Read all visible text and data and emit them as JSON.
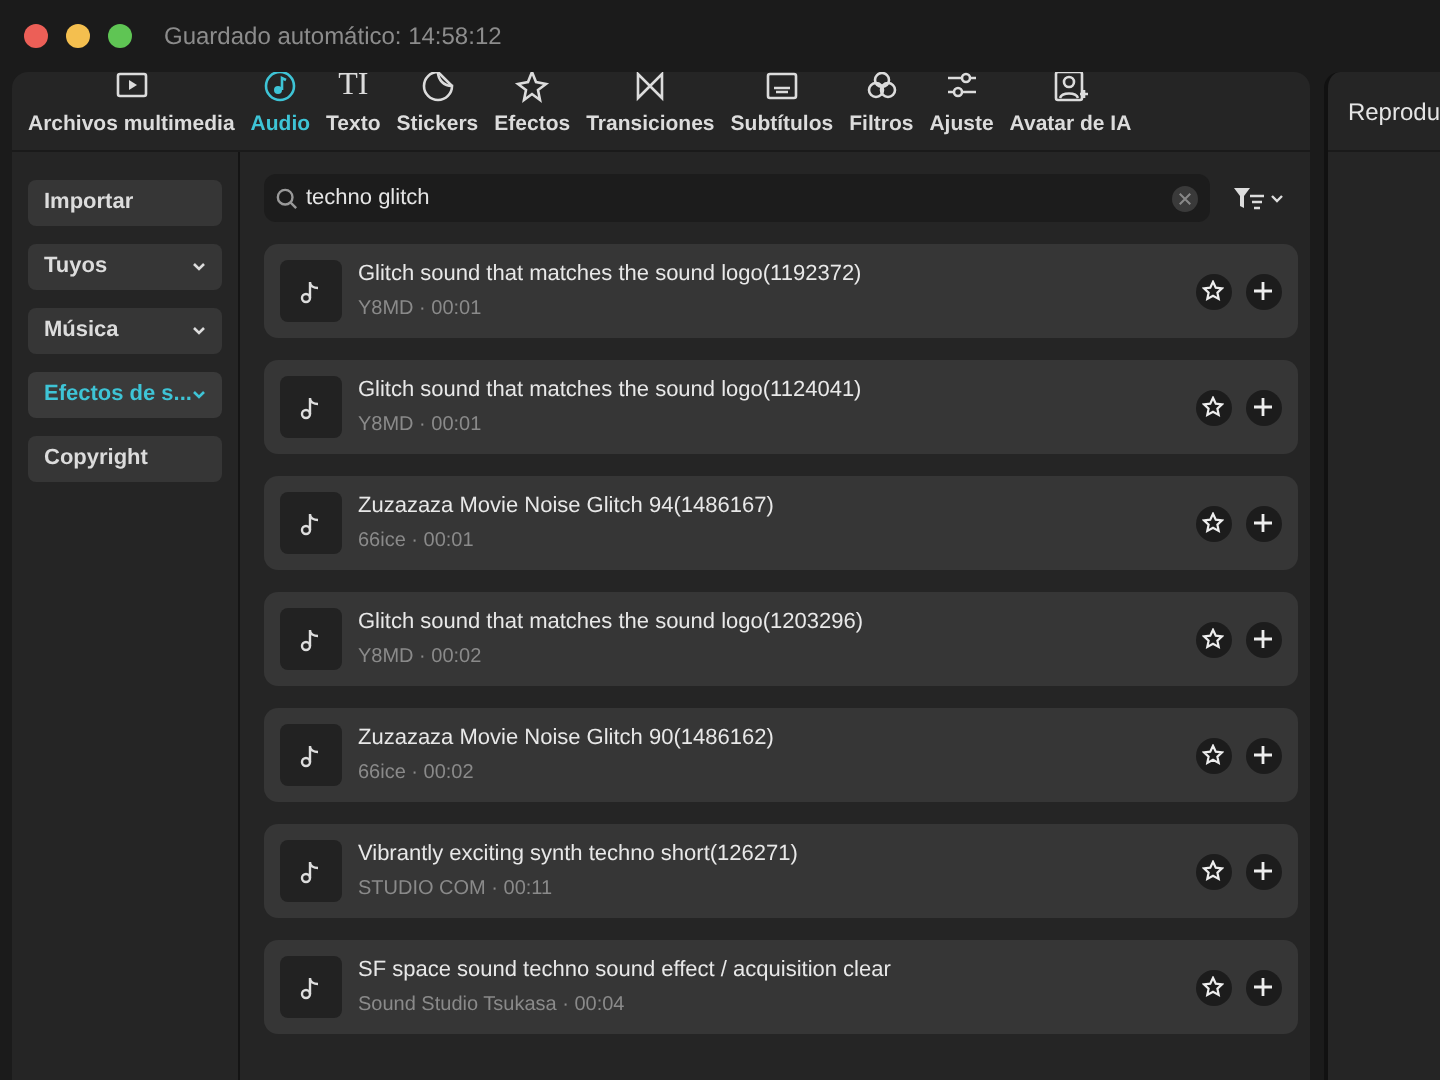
{
  "window": {
    "title": "Guardado automático: 14:58:12"
  },
  "tabs": [
    {
      "label": "Archivos multimedia",
      "selected": false
    },
    {
      "label": "Audio",
      "selected": true
    },
    {
      "label": "Texto",
      "glyph": "TI",
      "selected": false
    },
    {
      "label": "Stickers",
      "selected": false
    },
    {
      "label": "Efectos",
      "selected": false
    },
    {
      "label": "Transiciones",
      "selected": false
    },
    {
      "label": "Subtítulos",
      "selected": false
    },
    {
      "label": "Filtros",
      "selected": false
    },
    {
      "label": "Ajuste",
      "selected": false
    },
    {
      "label": "Avatar de IA",
      "selected": false
    }
  ],
  "sidebar": {
    "items": [
      {
        "label": "Importar",
        "dropdown": false,
        "selected": false
      },
      {
        "label": "Tuyos",
        "dropdown": true,
        "selected": false
      },
      {
        "label": "Música",
        "dropdown": true,
        "selected": false
      },
      {
        "label": "Efectos de s...",
        "dropdown": true,
        "selected": true
      },
      {
        "label": "Copyright",
        "dropdown": false,
        "selected": false
      }
    ]
  },
  "search": {
    "value": "techno glitch"
  },
  "results": [
    {
      "title": "Glitch sound that matches the sound logo(1192372)",
      "meta": "Y8MD · 00:01"
    },
    {
      "title": "Glitch sound that matches the sound logo(1124041)",
      "meta": "Y8MD · 00:01"
    },
    {
      "title": "Zuzazaza Movie Noise Glitch 94(1486167)",
      "meta": "66ice · 00:01"
    },
    {
      "title": "Glitch sound that matches the sound logo(1203296)",
      "meta": "Y8MD · 00:02"
    },
    {
      "title": "Zuzazaza Movie Noise Glitch 90(1486162)",
      "meta": "66ice · 00:02"
    },
    {
      "title": "Vibrantly exciting synth techno short(126271)",
      "meta": "STUDIO COM · 00:11"
    },
    {
      "title": "SF space sound techno sound effect / acquisition clear",
      "meta": "Sound Studio Tsukasa · 00:04"
    }
  ],
  "player_panel": {
    "title": "Reprodu"
  }
}
